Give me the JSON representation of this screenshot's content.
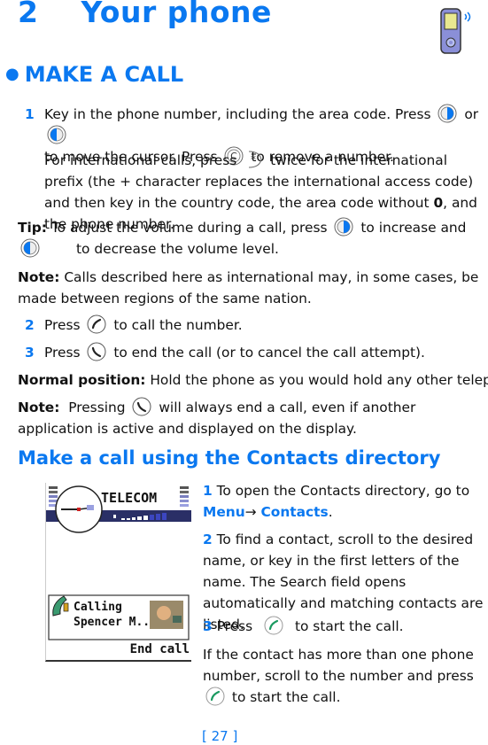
{
  "chapter": {
    "number": "2",
    "title": "Your phone"
  },
  "section": {
    "title": "MAKE A CALL"
  },
  "steps": {
    "s1_num": "1",
    "s1_line1a": "Key in the phone number, including the area code. Press",
    "s1_line1b": "or",
    "s1_line2a": "to move the cursor. Press",
    "s1_line2b": "to remove a number.",
    "s1_intl_a": "For international calls, press",
    "s1_intl_b": "twice for the international prefix (the + character replaces the international access code) and then key in the country code, the area code without",
    "s1_intl_zero": "0",
    "s1_intl_c": ", and the phone number.",
    "tip_label": "Tip:",
    "tip_a": "To adjust the volume during a call, press",
    "tip_b": "to increase and",
    "tip_c": "to decrease the volume level.",
    "note1_label": "Note:",
    "note1_text": "Calls described here as international may, in some cases, be made between regions of the same nation.",
    "s2_num": "2",
    "s2_a": "Press",
    "s2_b": "to call the number.",
    "s3_num": "3",
    "s3_a": "Press",
    "s3_b": "to end the call (or to cancel the call attempt).",
    "normal_label": "Normal position:",
    "normal_text": "Hold the phone as you would hold any other telephone.",
    "note2_label": "Note:",
    "note2_a": "Pressing",
    "note2_b": "will always end a call, even if another application is active and displayed on the display."
  },
  "subsection": {
    "title": "Make a call using the Contacts directory",
    "c1_num": "1",
    "c1_text": "To open the Contacts directory, go to",
    "c1_menu": "Menu",
    "c1_arrow": "→",
    "c1_contacts": "Contacts",
    "c1_end": ".",
    "c2_num": "2",
    "c2_text": "To find a contact, scroll to the desired name, or key in the first letters of the name. The Search field opens automatically and matching contacts are listed.",
    "c3_num": "3",
    "c3_a": "Press",
    "c3_b": "to start the call.",
    "c4_a": "If the contact has more than one phone number, scroll to the number and press",
    "c4_b": "to start the call."
  },
  "phone_screen": {
    "operator": "TELECOM",
    "calling": "Calling",
    "contact": "Spencer M..",
    "softkey": "End call"
  },
  "footer": {
    "page": "[ 27 ]"
  },
  "icons": {
    "joystick_right": "joystick-right-icon",
    "joystick_left": "joystick-left-icon",
    "clear_key": "clear-key-icon",
    "star_key": "star-key-icon",
    "call_key": "call-key-icon",
    "end_key": "end-key-icon",
    "phone_chapter": "phone-chapter-icon"
  },
  "colors": {
    "accent": "#0a78f0",
    "text": "#111111"
  }
}
